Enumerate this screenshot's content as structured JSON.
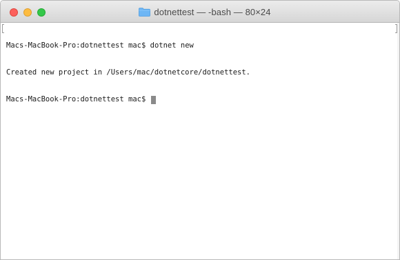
{
  "window": {
    "title": "dotnettest — -bash — 80×24"
  },
  "terminal": {
    "lines": [
      {
        "prompt": "Macs-MacBook-Pro:dotnettest mac$",
        "command": " dotnet new"
      },
      {
        "output": "Created new project in /Users/mac/dotnetcore/dotnettest."
      },
      {
        "prompt": "Macs-MacBook-Pro:dotnettest mac$",
        "command": " "
      }
    ]
  },
  "icons": {
    "title_icon": "folder-icon"
  },
  "colors": {
    "close": "#fc605c",
    "minimize": "#fdbc40",
    "zoom": "#34c84a",
    "folder": "#6eb6f5",
    "cursor": "#8a8a8a"
  }
}
